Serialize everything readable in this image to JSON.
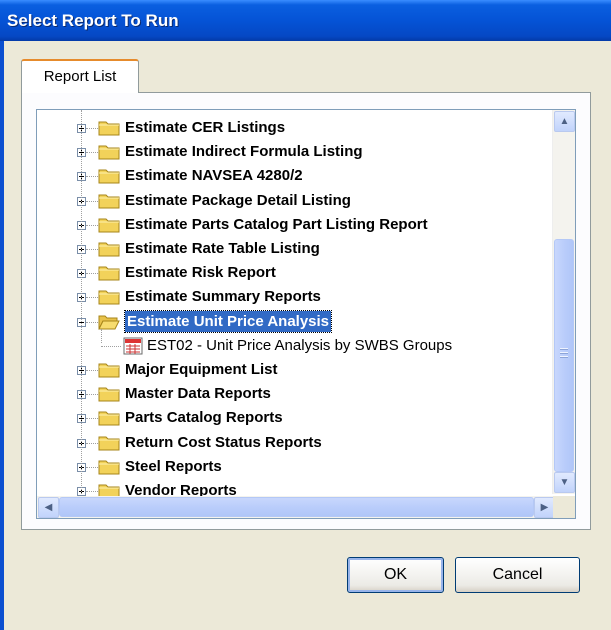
{
  "window": {
    "title": "Select Report To Run"
  },
  "tabs": [
    {
      "label": "Report List"
    }
  ],
  "tree": {
    "items": [
      {
        "label": "Estimate CER Listings",
        "expanded": false
      },
      {
        "label": "Estimate Indirect Formula Listing",
        "expanded": false
      },
      {
        "label": "Estimate NAVSEA 4280/2",
        "expanded": false
      },
      {
        "label": "Estimate Package Detail Listing",
        "expanded": false
      },
      {
        "label": "Estimate Parts Catalog Part Listing Report",
        "expanded": false
      },
      {
        "label": "Estimate Rate Table Listing",
        "expanded": false
      },
      {
        "label": "Estimate Risk Report",
        "expanded": false
      },
      {
        "label": "Estimate Summary Reports",
        "expanded": false
      },
      {
        "label": "Estimate Unit Price Analysis",
        "expanded": true,
        "selected": true
      },
      {
        "label": "EST02 - Unit Price Analysis by SWBS Groups",
        "is_report": true
      },
      {
        "label": "Major Equipment List",
        "expanded": false
      },
      {
        "label": "Master Data Reports",
        "expanded": false
      },
      {
        "label": "Parts Catalog Reports",
        "expanded": false
      },
      {
        "label": "Return Cost Status Reports",
        "expanded": false
      },
      {
        "label": "Steel Reports",
        "expanded": false
      },
      {
        "label": "Vendor Reports",
        "expanded": false
      }
    ]
  },
  "buttons": {
    "ok": "OK",
    "cancel": "Cancel"
  },
  "colors": {
    "titlebar": "#0553d6",
    "selection": "#316ac5",
    "folder": "#f2d25a"
  }
}
